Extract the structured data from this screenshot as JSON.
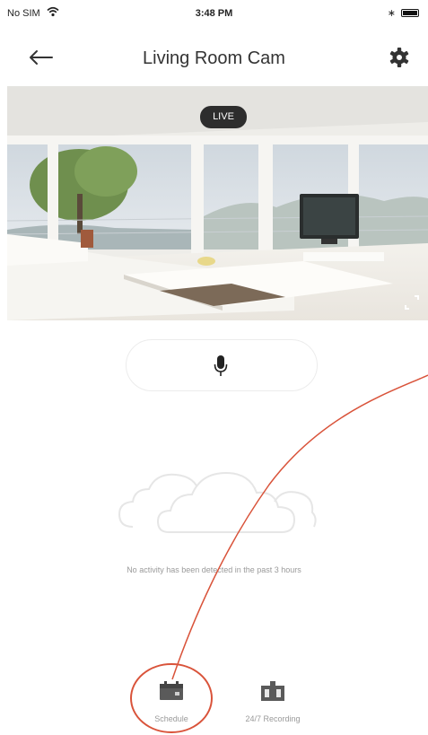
{
  "status_bar": {
    "carrier": "No SIM",
    "time": "3:48 PM"
  },
  "nav": {
    "title": "Living Room Cam",
    "back_icon": "arrow-left-icon",
    "settings_icon": "gear-icon"
  },
  "video": {
    "live_label": "LIVE",
    "fullscreen_icon": "fullscreen-icon"
  },
  "talk": {
    "icon": "microphone-icon"
  },
  "empty_state": {
    "icon": "cloud-icon",
    "message": "No activity has been detected in the past 3 hours"
  },
  "tabs": [
    {
      "label": "Schedule",
      "icon": "calendar-icon"
    },
    {
      "label": "24/7 Recording",
      "icon": "recording-icon"
    }
  ],
  "colors": {
    "annotation": "#d9533a",
    "muted_text": "#9a9a9a",
    "live_badge": "#2d2d2d"
  }
}
